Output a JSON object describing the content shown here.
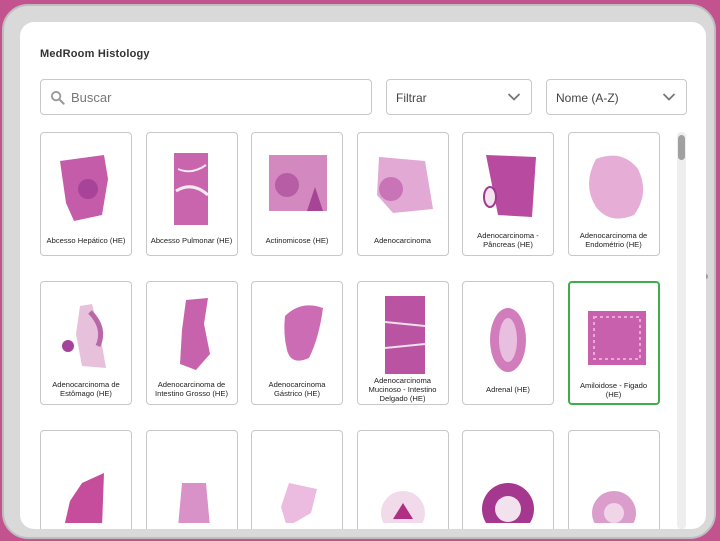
{
  "app": {
    "title": "MedRoom Histology"
  },
  "search": {
    "placeholder": "Buscar",
    "icon": "search-icon"
  },
  "filter": {
    "value": "Filtrar"
  },
  "sort": {
    "value": "Nome (A-Z)"
  },
  "colors": {
    "accent_selected": "#3fae49",
    "tissue": "#c05aa8",
    "background": "#c2538f"
  },
  "slides": [
    {
      "label": "Abcesso Hepático (HE)"
    },
    {
      "label": "Abcesso Pulmonar (HE)"
    },
    {
      "label": "Actinomicose (HE)"
    },
    {
      "label": "Adenocarcinoma"
    },
    {
      "label": "Adenocarcinoma - Pâncreas (HE)"
    },
    {
      "label": "Adenocarcinoma de Endométrio (HE)"
    },
    {
      "label": "Adenocarcinoma de Estômago (HE)"
    },
    {
      "label": "Adenocarcinoma de Intestino Grosso (HE)"
    },
    {
      "label": "Adenocarcinoma Gástrico (HE)"
    },
    {
      "label": "Adenocarcinoma Mucinoso - Intestino Delgado (HE)"
    },
    {
      "label": "Adrenal (HE)"
    },
    {
      "label": "Amiloidose - Figado (HE)",
      "selected": true
    },
    {
      "label": ""
    },
    {
      "label": ""
    },
    {
      "label": ""
    },
    {
      "label": ""
    },
    {
      "label": ""
    },
    {
      "label": ""
    }
  ]
}
